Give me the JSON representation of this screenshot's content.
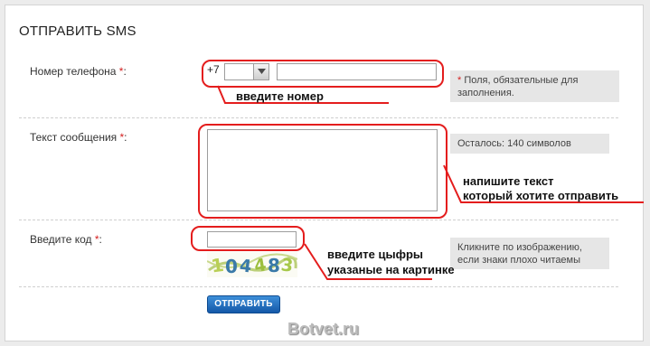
{
  "form": {
    "title": "ОТПРАВИТЬ SMS",
    "phone": {
      "label": "Номер телефона",
      "required_mark": "*",
      "suffix": ":",
      "prefix": "+7",
      "code_value": "",
      "number_value": ""
    },
    "message": {
      "label": "Текст сообщения",
      "required_mark": "*",
      "suffix": ":",
      "value": ""
    },
    "captcha": {
      "label": "Введите код",
      "required_mark": "*",
      "suffix": ":",
      "value": "",
      "image_text": "104483"
    },
    "submit_label": "ОТПРАВИТЬ"
  },
  "hints": {
    "required_mark": "*",
    "required_text": "Поля, обязательные для заполнения.",
    "remaining": "Осталось: 140 символов",
    "captcha_help": "Кликните по изображению, если знаки плохо читаемы"
  },
  "annotations": {
    "phone": "введите номер",
    "message_line1": "напишите текст",
    "message_line2": "который хотите отправить",
    "captcha_line1": "введите цыфры",
    "captcha_line2": "указаные на картинке",
    "color": "#e41d1d"
  },
  "watermark": "Botvet.ru"
}
